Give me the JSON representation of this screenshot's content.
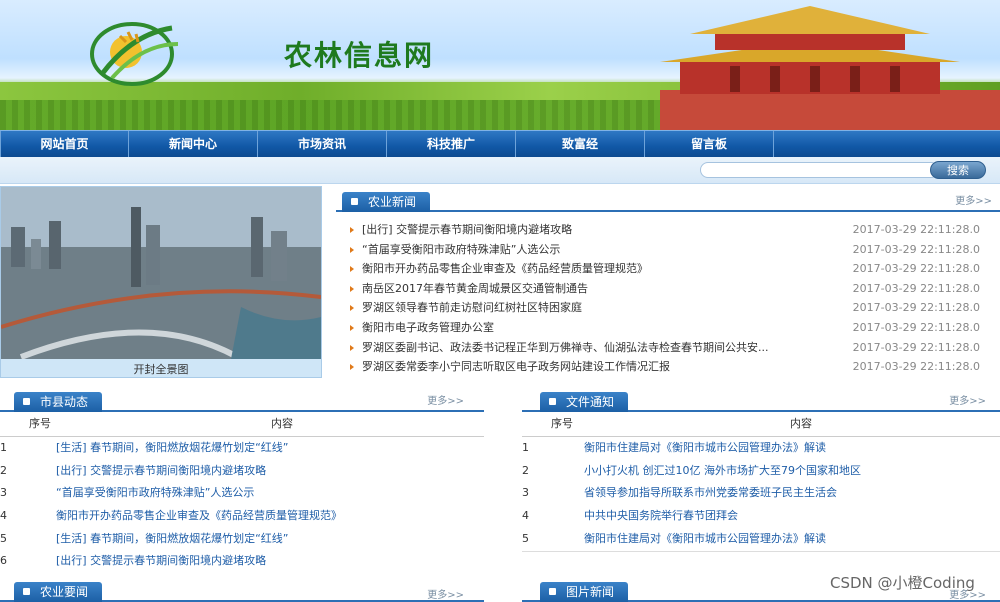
{
  "site": {
    "name": "农林信息网"
  },
  "nav": [
    "网站首页",
    "新闻中心",
    "市场资讯",
    "科技推广",
    "致富经",
    "留言板"
  ],
  "search": {
    "placeholder": "",
    "button": "搜索"
  },
  "photo": {
    "caption": "开封全景图"
  },
  "agri_news": {
    "title": "农业新闻",
    "more": "更多>>",
    "items": [
      {
        "title": "[出行] 交警提示春节期间衡阳境内避堵攻略",
        "date": "2017-03-29 22:11:28.0"
      },
      {
        "title": "“首届享受衡阳市政府特殊津贴”人选公示",
        "date": "2017-03-29 22:11:28.0"
      },
      {
        "title": "衡阳市开办药品零售企业审查及《药品经营质量管理规范》",
        "date": "2017-03-29 22:11:28.0"
      },
      {
        "title": "南岳区2017年春节黄金周城景区交通管制通告",
        "date": "2017-03-29 22:11:28.0"
      },
      {
        "title": "罗湖区领导春节前走访慰问红树社区特困家庭",
        "date": "2017-03-29 22:11:28.0"
      },
      {
        "title": "衡阳市电子政务管理办公室",
        "date": "2017-03-29 22:11:28.0"
      },
      {
        "title": "罗湖区委副书记、政法委书记程正华到万佛禅寺、仙湖弘法寺检查春节期间公共安...",
        "date": "2017-03-29 22:11:28.0"
      },
      {
        "title": "罗湖区委常委李小宁同志听取区电子政务网站建设工作情况汇报",
        "date": "2017-03-29 22:11:28.0"
      }
    ]
  },
  "county": {
    "title": "市县动态",
    "more": "更多>>",
    "col_no": "序号",
    "col_content": "内容",
    "rows": [
      {
        "no": "1",
        "text": "[生活] 春节期间，衡阳燃放烟花爆竹划定“红线”"
      },
      {
        "no": "2",
        "text": "[出行] 交警提示春节期间衡阳境内避堵攻略"
      },
      {
        "no": "3",
        "text": "“首届享受衡阳市政府特殊津贴”人选公示"
      },
      {
        "no": "4",
        "text": "衡阳市开办药品零售企业审查及《药品经营质量管理规范》"
      },
      {
        "no": "5",
        "text": "[生活] 春节期间，衡阳燃放烟花爆竹划定“红线”"
      },
      {
        "no": "6",
        "text": "[出行] 交警提示春节期间衡阳境内避堵攻略"
      }
    ]
  },
  "docs": {
    "title": "文件通知",
    "more": "更多>>",
    "col_no": "序号",
    "col_content": "内容",
    "rows": [
      {
        "no": "1",
        "text": "衡阳市住建局对《衡阳市城市公园管理办法》解读"
      },
      {
        "no": "2",
        "text": "小小打火机 创汇过10亿 海外市场扩大至79个国家和地区"
      },
      {
        "no": "3",
        "text": "省领导参加指导所联系市州党委常委班子民主生活会"
      },
      {
        "no": "4",
        "text": "中共中央国务院举行春节团拜会"
      },
      {
        "no": "5",
        "text": "衡阳市住建局对《衡阳市城市公园管理办法》解读"
      }
    ]
  },
  "agri_key": {
    "title": "农业要闻",
    "more": "更多>>"
  },
  "pic_news": {
    "title": "图片新闻",
    "more": "更多>>"
  },
  "watermark": "CSDN @小橙Coding",
  "colors": {
    "nav": "#1158a6",
    "accent": "#2c6fb5",
    "bullet": "#e07a1a",
    "link": "#1f5ea8"
  }
}
